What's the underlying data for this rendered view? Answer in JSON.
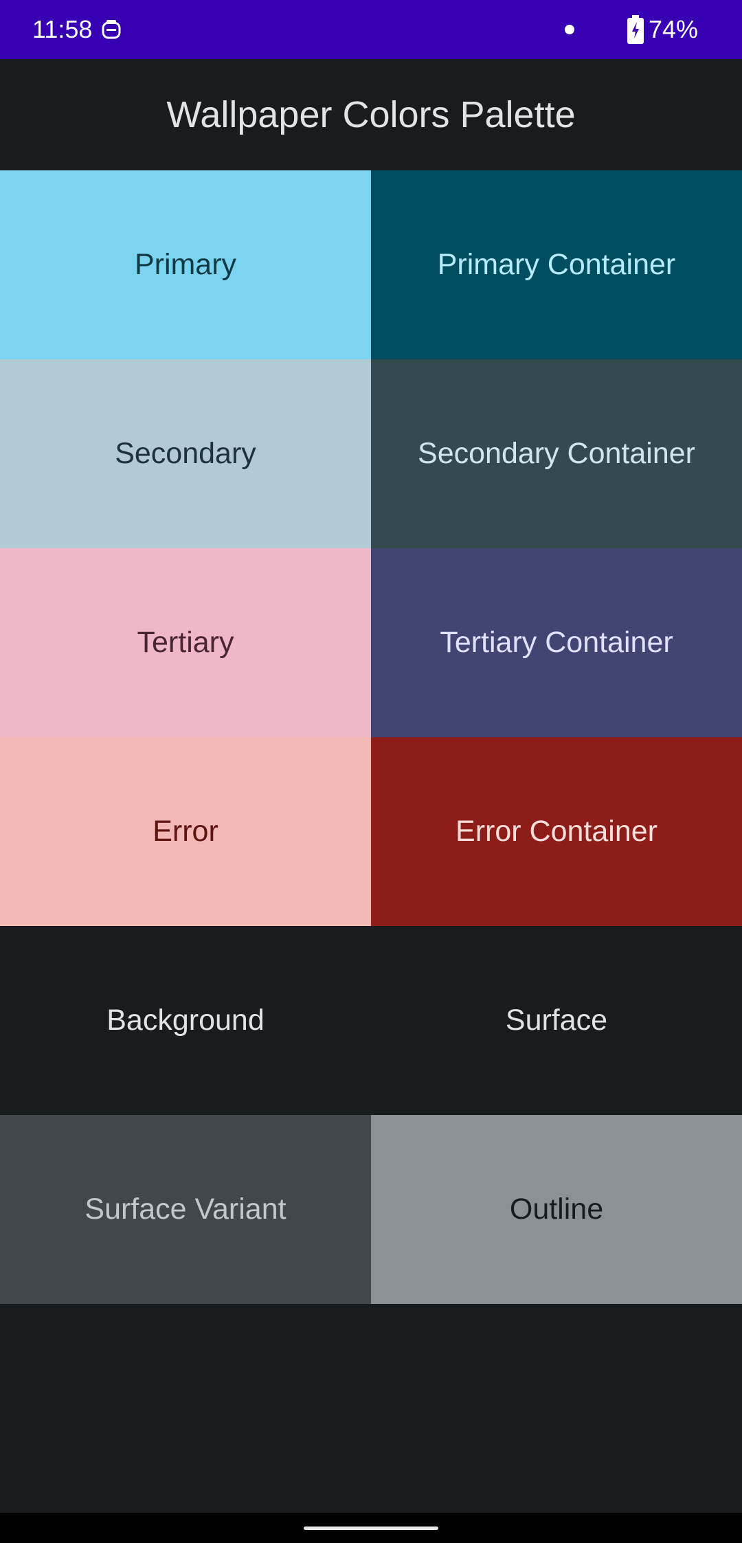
{
  "status_bar": {
    "time": "11:58",
    "battery": "74%",
    "icons": [
      "notification-icon",
      "dot-icon",
      "battery-charging-icon"
    ],
    "background": "#3700b3"
  },
  "app_bar": {
    "title": "Wallpaper Colors Palette"
  },
  "palette": [
    {
      "label": "Primary",
      "bg": "#7bd4ef",
      "fg": "#0f3a46"
    },
    {
      "label": "Primary Container",
      "bg": "#004e60",
      "fg": "#b6ecff"
    },
    {
      "label": "Secondary",
      "bg": "#b2cad3",
      "fg": "#1c333b"
    },
    {
      "label": "Secondary Container",
      "bg": "#334a51",
      "fg": "#cde6ef"
    },
    {
      "label": "Tertiary",
      "bg": "#efb8c8",
      "fg": "#4a2532"
    },
    {
      "label": "Tertiary Container",
      "bg": "#404571",
      "fg": "#e0e2ff"
    },
    {
      "label": "Error",
      "bg": "#f2b8b5",
      "fg": "#601410"
    },
    {
      "label": "Error Container",
      "bg": "#8c1d18",
      "fg": "#f9dedc"
    },
    {
      "label": "Background",
      "bg": "#191c1e",
      "fg": "#e1e3e4"
    },
    {
      "label": "Surface",
      "bg": "#191c1e",
      "fg": "#e1e3e4"
    },
    {
      "label": "Surface Variant",
      "bg": "#40484b",
      "fg": "#c0c8cc"
    },
    {
      "label": "Outline",
      "bg": "#8a9296",
      "fg": "#191c1e"
    }
  ]
}
